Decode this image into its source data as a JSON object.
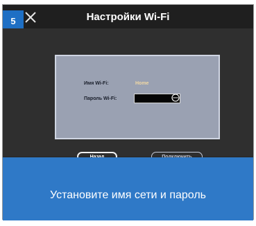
{
  "step": "5",
  "header": {
    "title": "Настройки Wi-Fi"
  },
  "dialog": {
    "ssid_label": "Имя Wi-Fi:",
    "ssid_value": "Home",
    "password_label": "Пароль Wi-Fi:",
    "password_value": "",
    "back_button": "Назад",
    "connect_button": "Подключить"
  },
  "footer": {
    "instruction": "Установите имя сети и пароль"
  },
  "colors": {
    "accent_blue": "#2f79c7",
    "badge_blue": "#1e6fc4",
    "dialog_bg": "#9aa1b2"
  },
  "icons": {
    "close": "close-icon",
    "visibility": "eye-icon"
  }
}
